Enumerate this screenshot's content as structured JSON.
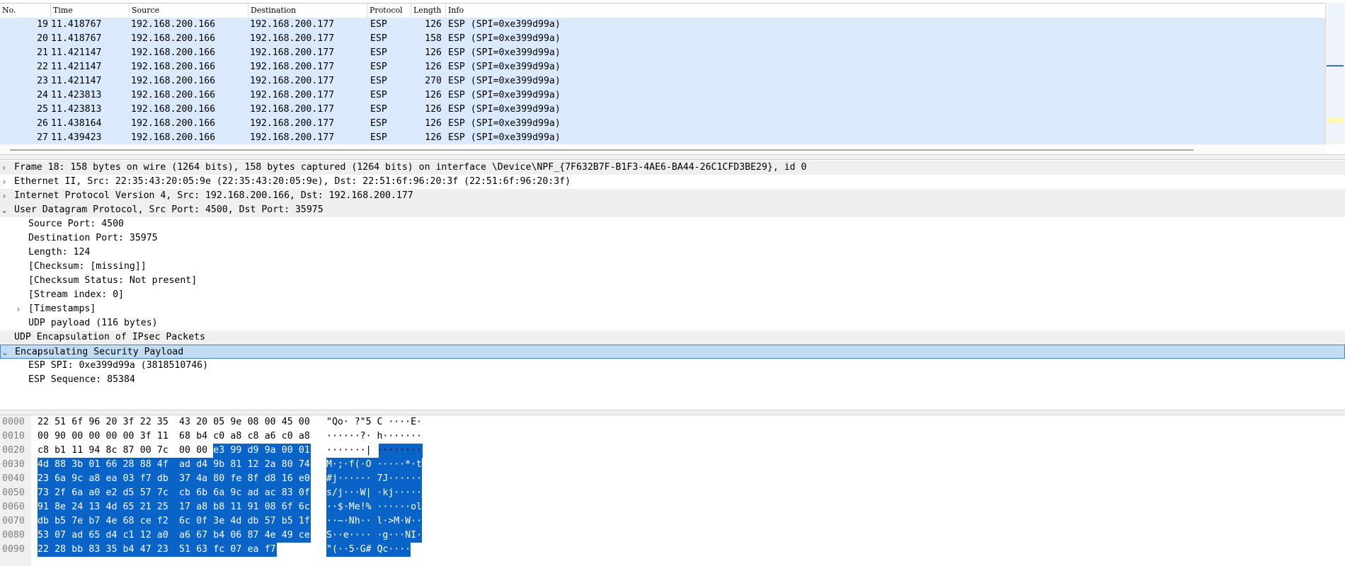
{
  "packet_list": {
    "columns": {
      "no": "No.",
      "time": "Time",
      "source": "Source",
      "destination": "Destination",
      "protocol": "Protocol",
      "length": "Length",
      "info": "Info"
    },
    "rows": [
      {
        "no": "19",
        "time": "11.418767",
        "source": "192.168.200.166",
        "destination": "192.168.200.177",
        "protocol": "ESP",
        "length": "126",
        "info": "ESP (SPI=0xe399d99a)"
      },
      {
        "no": "20",
        "time": "11.418767",
        "source": "192.168.200.166",
        "destination": "192.168.200.177",
        "protocol": "ESP",
        "length": "158",
        "info": "ESP (SPI=0xe399d99a)"
      },
      {
        "no": "21",
        "time": "11.421147",
        "source": "192.168.200.166",
        "destination": "192.168.200.177",
        "protocol": "ESP",
        "length": "126",
        "info": "ESP (SPI=0xe399d99a)"
      },
      {
        "no": "22",
        "time": "11.421147",
        "source": "192.168.200.166",
        "destination": "192.168.200.177",
        "protocol": "ESP",
        "length": "126",
        "info": "ESP (SPI=0xe399d99a)"
      },
      {
        "no": "23",
        "time": "11.421147",
        "source": "192.168.200.166",
        "destination": "192.168.200.177",
        "protocol": "ESP",
        "length": "270",
        "info": "ESP (SPI=0xe399d99a)"
      },
      {
        "no": "24",
        "time": "11.423813",
        "source": "192.168.200.166",
        "destination": "192.168.200.177",
        "protocol": "ESP",
        "length": "126",
        "info": "ESP (SPI=0xe399d99a)"
      },
      {
        "no": "25",
        "time": "11.423813",
        "source": "192.168.200.166",
        "destination": "192.168.200.177",
        "protocol": "ESP",
        "length": "126",
        "info": "ESP (SPI=0xe399d99a)"
      },
      {
        "no": "26",
        "time": "11.438164",
        "source": "192.168.200.166",
        "destination": "192.168.200.177",
        "protocol": "ESP",
        "length": "126",
        "info": "ESP (SPI=0xe399d99a)"
      },
      {
        "no": "27",
        "time": "11.439423",
        "source": "192.168.200.166",
        "destination": "192.168.200.177",
        "protocol": "ESP",
        "length": "126",
        "info": "ESP (SPI=0xe399d99a)"
      }
    ],
    "row_color": "#dae9fb"
  },
  "details": {
    "lines": [
      {
        "text": "Frame 18: 158 bytes on wire (1264 bits), 158 bytes captured (1264 bits) on interface \\Device\\NPF_{7F632B7F-B1F3-4AE6-BA44-26C1CFD3BE29}, id 0",
        "arrow": "›",
        "indent": 0,
        "style": "gray"
      },
      {
        "text": "Ethernet II, Src: 22:35:43:20:05:9e (22:35:43:20:05:9e), Dst: 22:51:6f:96:20:3f (22:51:6f:96:20:3f)",
        "arrow": "›",
        "indent": 0,
        "style": "plain"
      },
      {
        "text": "Internet Protocol Version 4, Src: 192.168.200.166, Dst: 192.168.200.177",
        "arrow": "›",
        "indent": 0,
        "style": "gray"
      },
      {
        "text": "User Datagram Protocol, Src Port: 4500, Dst Port: 35975",
        "arrow": "⌄",
        "indent": 0,
        "style": "gray"
      },
      {
        "text": "Source Port: 4500",
        "arrow": "",
        "indent": 1,
        "style": "plain"
      },
      {
        "text": "Destination Port: 35975",
        "arrow": "",
        "indent": 1,
        "style": "plain"
      },
      {
        "text": "Length: 124",
        "arrow": "",
        "indent": 1,
        "style": "plain"
      },
      {
        "text": "[Checksum: [missing]]",
        "arrow": "",
        "indent": 1,
        "style": "plain"
      },
      {
        "text": "[Checksum Status: Not present]",
        "arrow": "",
        "indent": 1,
        "style": "plain"
      },
      {
        "text": "[Stream index: 0]",
        "arrow": "",
        "indent": 1,
        "style": "plain"
      },
      {
        "text": "[Timestamps]",
        "arrow": "›",
        "indent": 1,
        "style": "plain"
      },
      {
        "text": "UDP payload (116 bytes)",
        "arrow": "",
        "indent": 1,
        "style": "plain"
      },
      {
        "text": "UDP Encapsulation of IPsec Packets",
        "arrow": "",
        "indent": 0,
        "style": "gray"
      },
      {
        "text": "Encapsulating Security Payload",
        "arrow": "⌄",
        "indent": 0,
        "style": "selected"
      },
      {
        "text": "ESP SPI: 0xe399d99a (3818510746)",
        "arrow": "",
        "indent": 1,
        "style": "plain"
      },
      {
        "text": "ESP Sequence: 85384",
        "arrow": "",
        "indent": 1,
        "style": "plain"
      }
    ],
    "selected_color": "#c1dcf3",
    "gray_color": "#efefef"
  },
  "hex": {
    "highlight_color": "#0a64c8",
    "highlight_start": 42,
    "rows": [
      {
        "offset": "0000",
        "bytes": [
          "22",
          "51",
          "6f",
          "96",
          "20",
          "3f",
          "22",
          "35",
          "43",
          "20",
          "05",
          "9e",
          "08",
          "00",
          "45",
          "00"
        ],
        "ascii": "\"Qo· ?\"5 C ····E·"
      },
      {
        "offset": "0010",
        "bytes": [
          "00",
          "90",
          "00",
          "00",
          "00",
          "00",
          "3f",
          "11",
          "68",
          "b4",
          "c0",
          "a8",
          "c8",
          "a6",
          "c0",
          "a8"
        ],
        "ascii": "······?· h·······"
      },
      {
        "offset": "0020",
        "bytes": [
          "c8",
          "b1",
          "11",
          "94",
          "8c",
          "87",
          "00",
          "7c",
          "00",
          "00",
          "e3",
          "99",
          "d9",
          "9a",
          "00",
          "01"
        ],
        "ascii": "·······| ········"
      },
      {
        "offset": "0030",
        "bytes": [
          "4d",
          "88",
          "3b",
          "01",
          "66",
          "28",
          "88",
          "4f",
          "ad",
          "d4",
          "9b",
          "81",
          "12",
          "2a",
          "80",
          "74"
        ],
        "ascii": "M·;·f(·O ·····*·t"
      },
      {
        "offset": "0040",
        "bytes": [
          "23",
          "6a",
          "9c",
          "a8",
          "ea",
          "03",
          "f7",
          "db",
          "37",
          "4a",
          "80",
          "fe",
          "8f",
          "d8",
          "16",
          "e0"
        ],
        "ascii": "#j······ 7J······"
      },
      {
        "offset": "0050",
        "bytes": [
          "73",
          "2f",
          "6a",
          "a0",
          "e2",
          "d5",
          "57",
          "7c",
          "cb",
          "6b",
          "6a",
          "9c",
          "ad",
          "ac",
          "83",
          "0f"
        ],
        "ascii": "s/j···W| ·kj·····"
      },
      {
        "offset": "0060",
        "bytes": [
          "91",
          "8e",
          "24",
          "13",
          "4d",
          "65",
          "21",
          "25",
          "17",
          "a8",
          "b8",
          "11",
          "91",
          "08",
          "6f",
          "6c"
        ],
        "ascii": "··$·Me!% ······ol"
      },
      {
        "offset": "0070",
        "bytes": [
          "db",
          "b5",
          "7e",
          "b7",
          "4e",
          "68",
          "ce",
          "f2",
          "6c",
          "0f",
          "3e",
          "4d",
          "db",
          "57",
          "b5",
          "1f"
        ],
        "ascii": "··~·Nh·· l·>M·W··"
      },
      {
        "offset": "0080",
        "bytes": [
          "53",
          "07",
          "ad",
          "65",
          "d4",
          "c1",
          "12",
          "a0",
          "a6",
          "67",
          "b4",
          "06",
          "87",
          "4e",
          "49",
          "ce"
        ],
        "ascii": "S··e···· ·g···NI·"
      },
      {
        "offset": "0090",
        "bytes": [
          "22",
          "28",
          "bb",
          "83",
          "35",
          "b4",
          "47",
          "23",
          "51",
          "63",
          "fc",
          "07",
          "ea",
          "f7"
        ],
        "ascii": "\"(··5·G# Qc····"
      }
    ]
  }
}
